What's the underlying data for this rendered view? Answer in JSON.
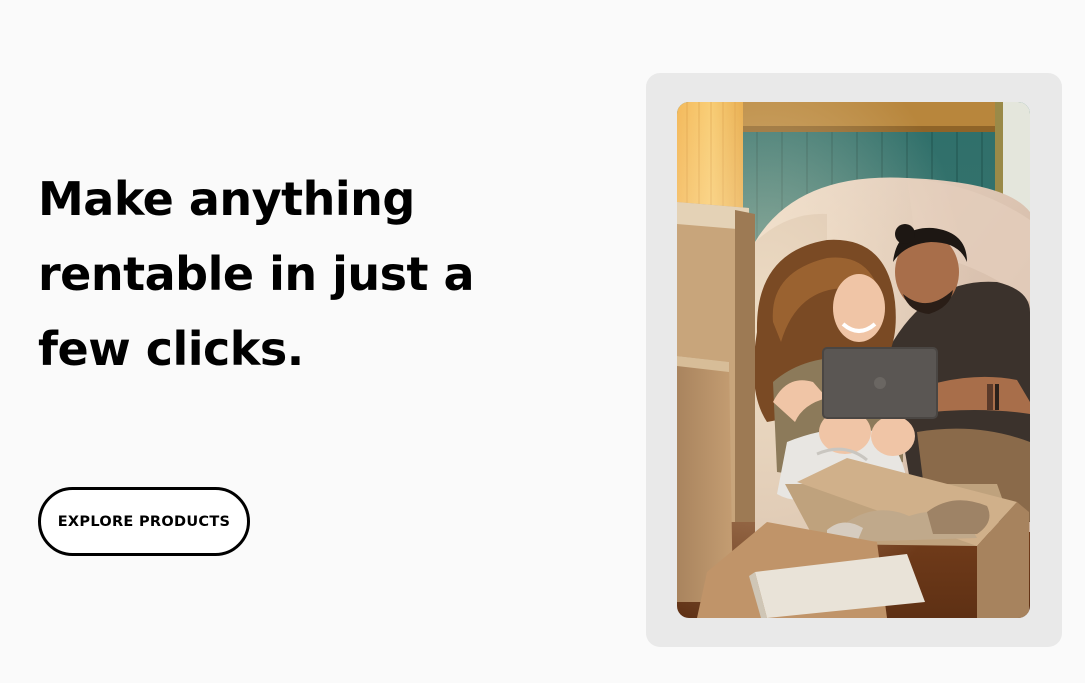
{
  "hero": {
    "headline": "Make anything rentable in just a few clicks.",
    "cta_label": "EXPLORE PRODUCTS",
    "image": {
      "subject": "couple-moving-in-laptop-photo"
    }
  },
  "colors": {
    "background": "#fafafa",
    "text": "#000000",
    "frame": "#e9e9e9",
    "button_border": "#000000"
  }
}
